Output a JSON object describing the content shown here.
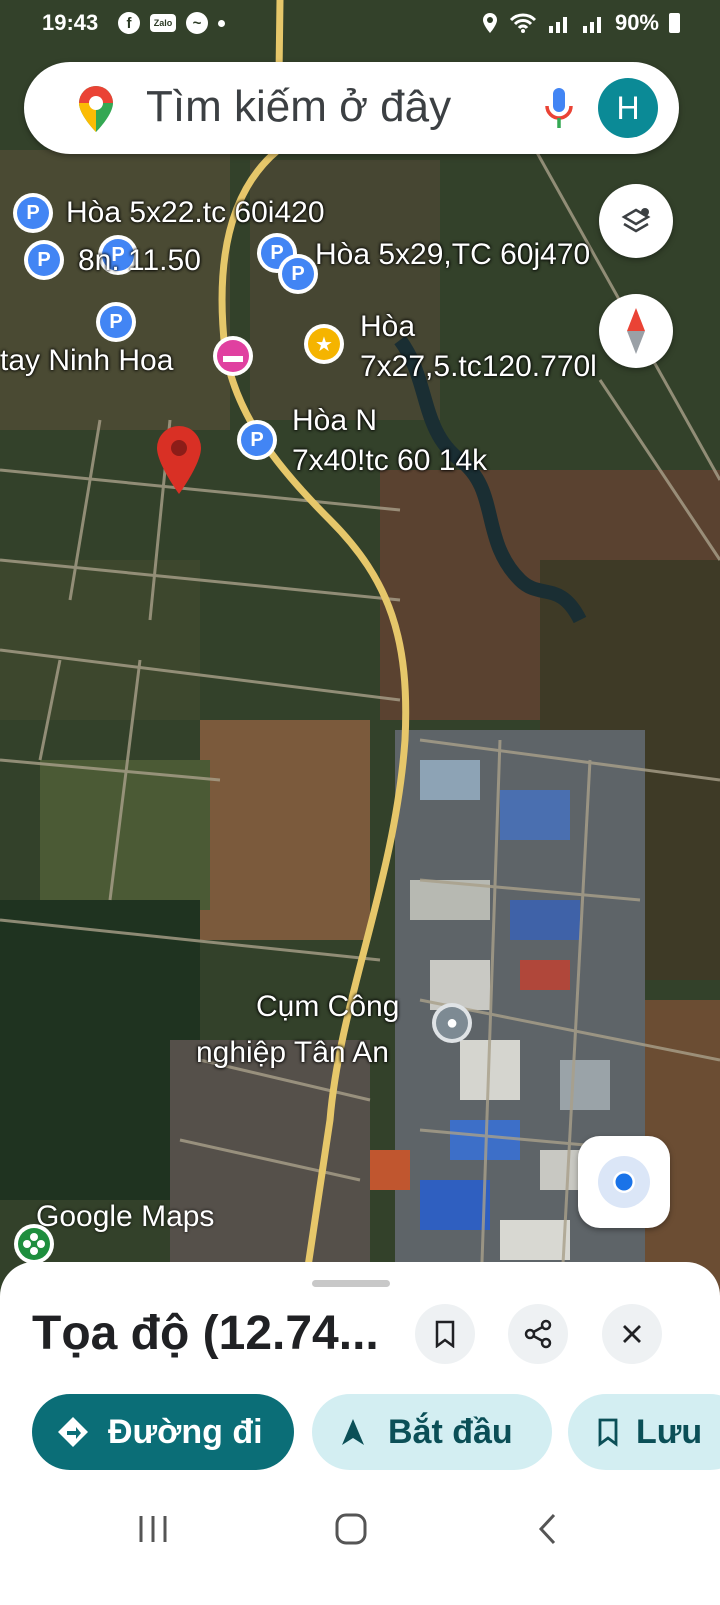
{
  "status_bar": {
    "time": "19:43",
    "battery": "90%",
    "icons": [
      "facebook-icon",
      "zalo-icon",
      "messenger-icon",
      "location-icon",
      "wifi-icon",
      "signal-icon",
      "battery-icon"
    ]
  },
  "search": {
    "placeholder": "Tìm kiếm ở đây",
    "avatar_letter": "H"
  },
  "map": {
    "labels": {
      "l1": "Hòa 5x22.tc 60i420",
      "l2": "8n. 11.50",
      "l3": "Hòa 5x29,TC 60j470",
      "l4a": "Hòa",
      "l4b": "7x27,5.tc120.770l",
      "l5": "tay Ninh Hoa",
      "l6a": "Hòa N",
      "l6b": "7x40!tc 60 14k",
      "l7a": "Cụm Công",
      "l7b": "nghiệp Tân An"
    },
    "watermark": "Google Maps",
    "colors": {
      "parking_pin": "#4285f4",
      "dropped_pin": "#d93025",
      "hotel_pin": "#e040a0",
      "star_pin": "#f5b400",
      "road": "#e6c76a",
      "location_dot": "#1a73e8"
    }
  },
  "sheet": {
    "title": "Tọa độ (12.74...",
    "buttons": {
      "directions": "Đường đi",
      "start": "Bắt đầu",
      "save": "Lưu"
    },
    "colors": {
      "primary": "#0b6e77",
      "secondary_bg": "#d3eef2"
    }
  }
}
